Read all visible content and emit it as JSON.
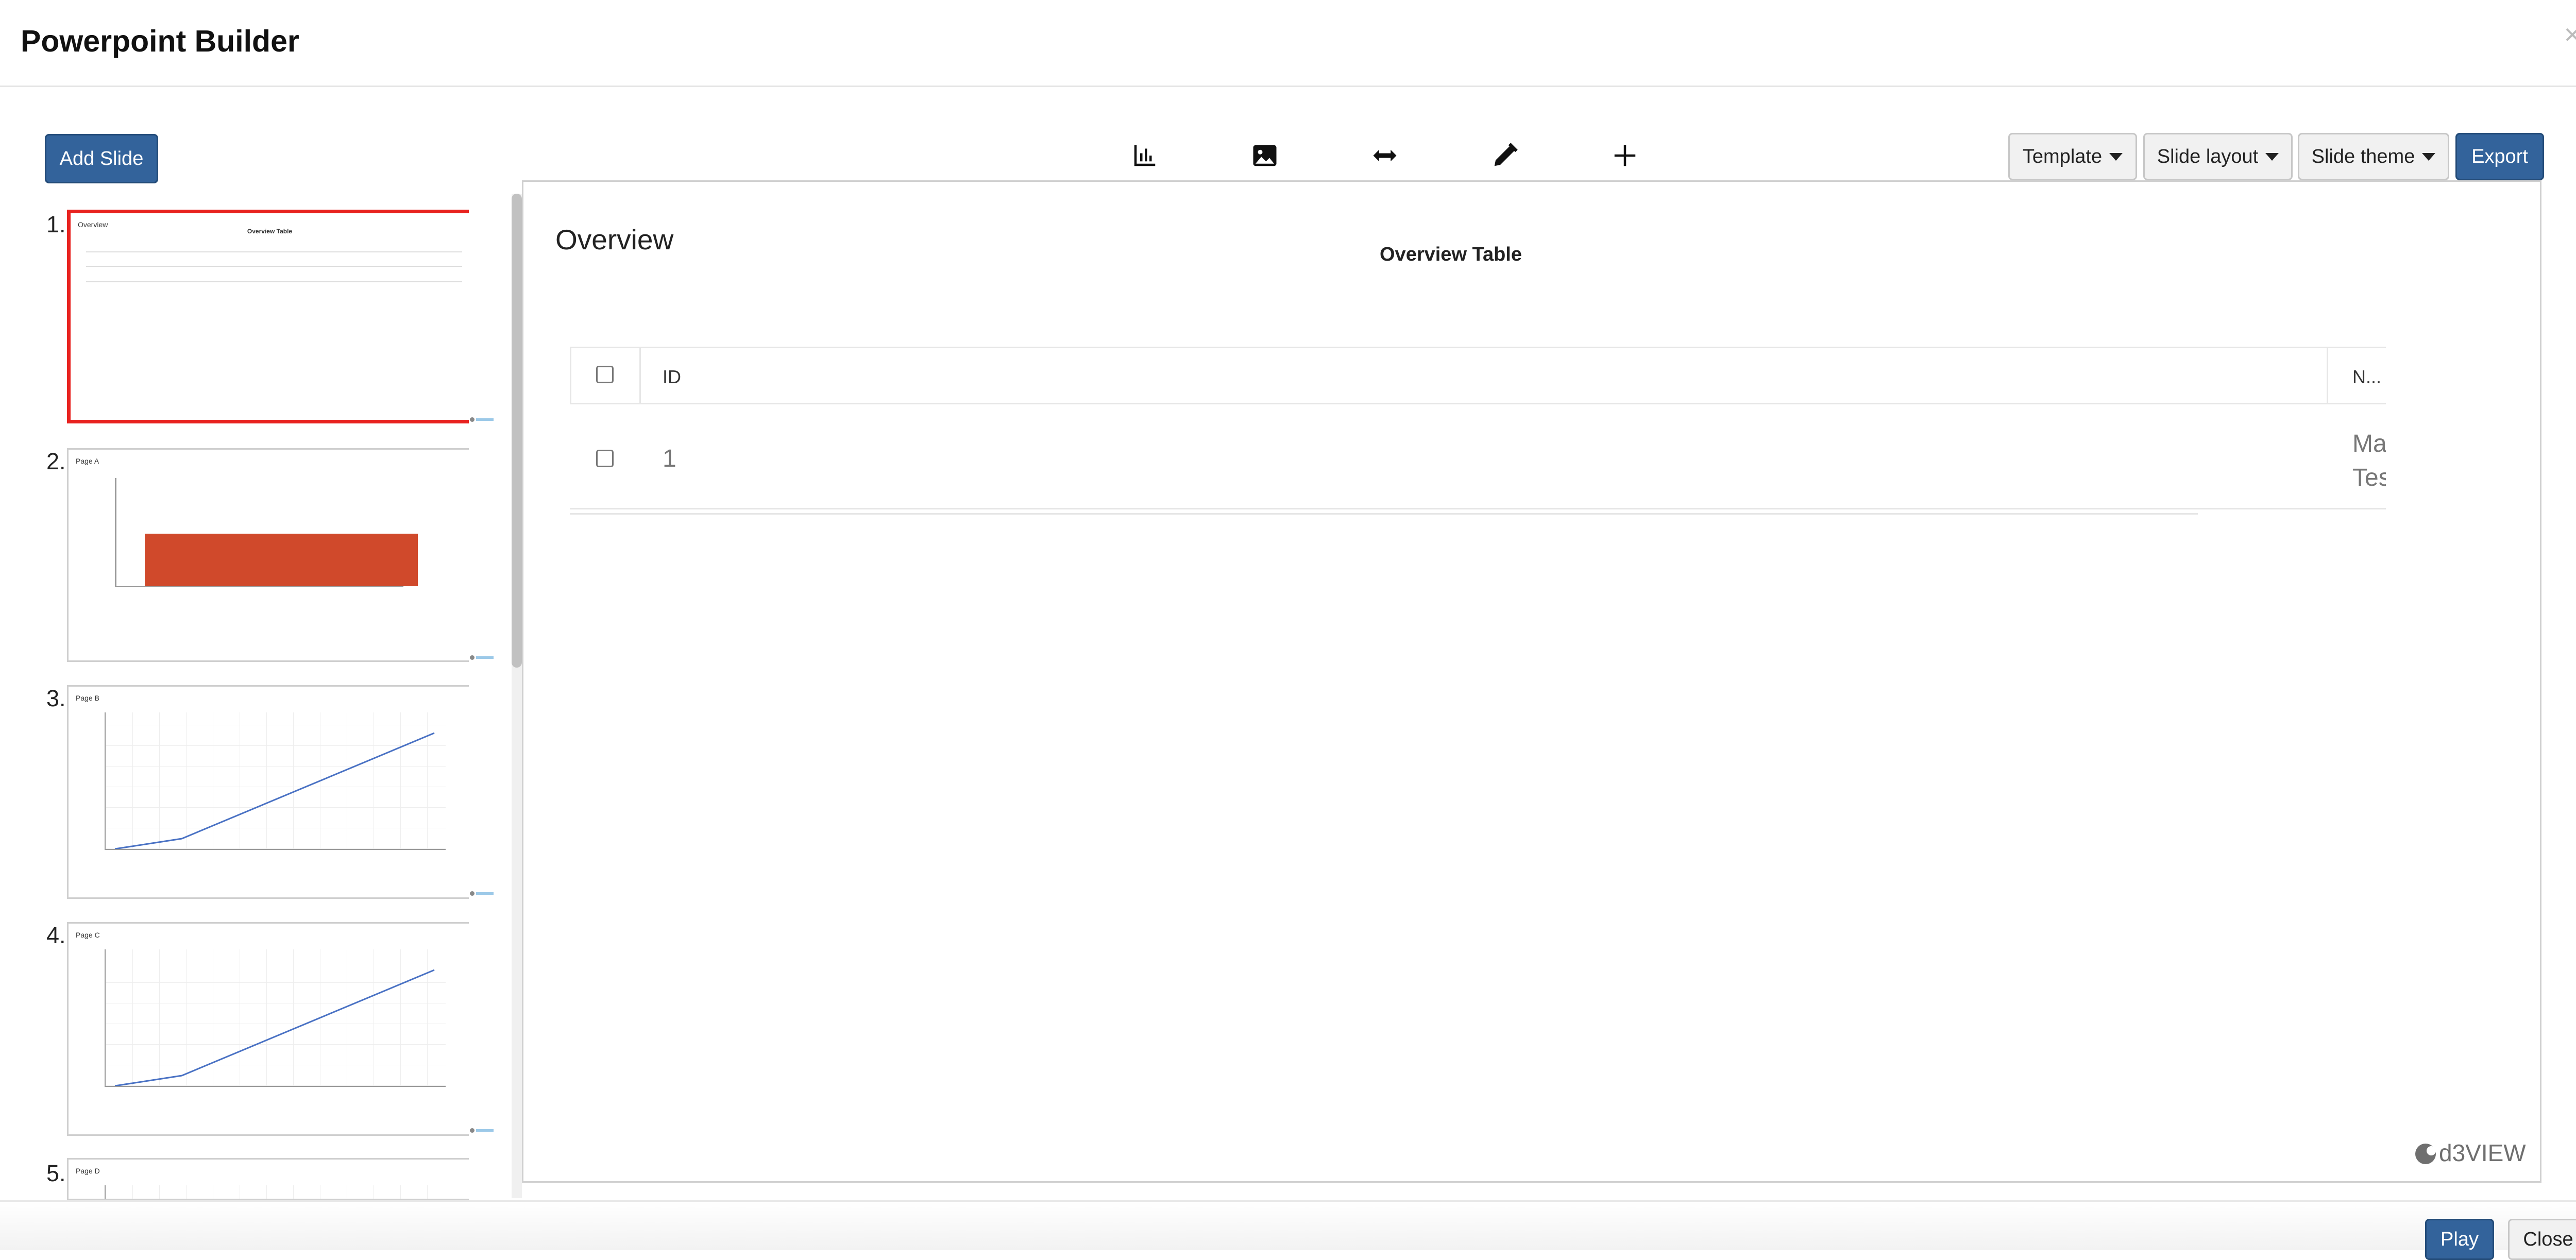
{
  "header": {
    "title": "Powerpoint Builder",
    "close_glyph": "×"
  },
  "toolbar": {
    "add_slide": "Add Slide",
    "icons": [
      "bar-chart-icon",
      "image-icon",
      "arrows-horizontal-icon",
      "pencil-icon",
      "plus-icon"
    ],
    "template": "Template",
    "slide_layout": "Slide layout",
    "slide_theme": "Slide theme",
    "export": "Export"
  },
  "thumbnails": [
    {
      "num": "1.",
      "title": "Overview",
      "heading": "Overview Table",
      "active": true
    },
    {
      "num": "2.",
      "title": "Page A",
      "heading": "",
      "active": false
    },
    {
      "num": "3.",
      "title": "Page B",
      "heading": "",
      "active": false
    },
    {
      "num": "4.",
      "title": "Page C",
      "heading": "",
      "active": false
    },
    {
      "num": "5.",
      "title": "Page D",
      "heading": "",
      "active": false
    }
  ],
  "slide": {
    "title": "Overview",
    "table_title": "Overview Table",
    "columns": [
      "ID",
      "N..."
    ],
    "rows": [
      {
        "id": "1",
        "name_lines": [
          "Ma",
          "Tes"
        ]
      }
    ],
    "logo": "d3VIEW"
  },
  "footer": {
    "play": "Play",
    "close": "Close"
  },
  "colors": {
    "primary": "#33639b",
    "active_border": "#e8221f",
    "bar": "#d0492b",
    "line": "#4a72c4"
  }
}
